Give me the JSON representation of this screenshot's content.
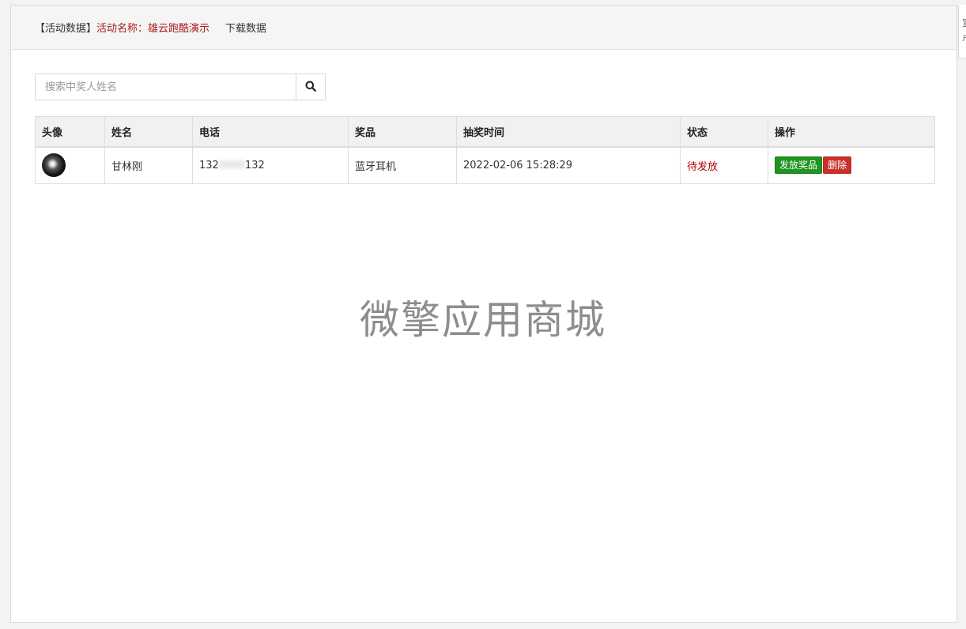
{
  "header": {
    "title": "【活动数据】",
    "activity_label": "活动名称：雄云跑酷演示",
    "download_label": "下载数据"
  },
  "search": {
    "placeholder": "搜索中奖人姓名",
    "value": "",
    "button_icon": "search-icon"
  },
  "table": {
    "columns": [
      "头像",
      "姓名",
      "电话",
      "奖品",
      "抽奖时间",
      "状态",
      "操作"
    ],
    "rows": [
      {
        "avatar_icon": "avatar",
        "name": "甘林刚",
        "phone_prefix": "132",
        "phone_masked": "0000",
        "phone_suffix": "132",
        "prize": "蓝牙耳机",
        "time": "2022-02-06 15:28:29",
        "status": "待发放",
        "actions": {
          "issue": "发放奖品",
          "delete": "删除"
        }
      }
    ]
  },
  "watermark": "微擎应用商城",
  "edge_tab": {
    "text": "宣 卢"
  },
  "colors": {
    "status_pending": "#b30000",
    "activity_label": "#a91b1b",
    "issue_button": "#1f9421",
    "delete_button": "#c9302c"
  }
}
